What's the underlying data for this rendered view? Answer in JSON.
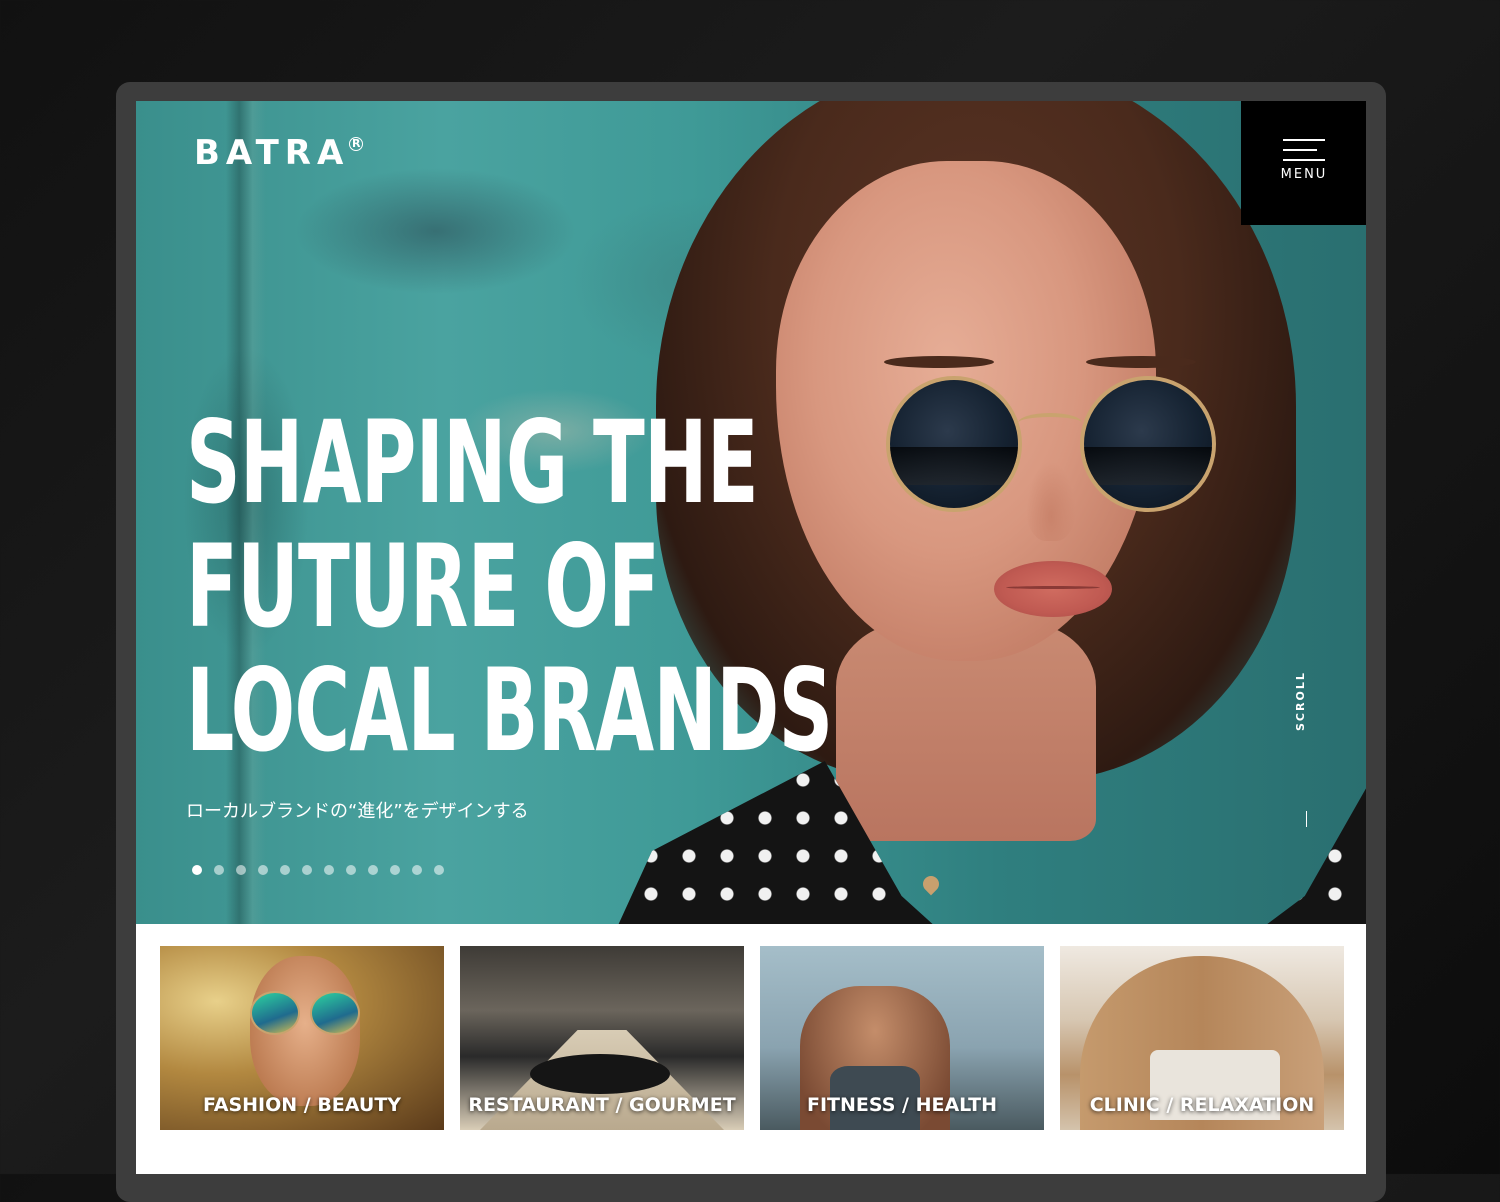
{
  "brand": {
    "name": "BATRA",
    "mark": "R"
  },
  "menu": {
    "label": "MENU"
  },
  "hero": {
    "headline_lines": [
      "SHAPING THE",
      "FUTURE OF",
      "LOCAL BRANDS"
    ],
    "subline": "ローカルブランドの“進化”をデザインする",
    "slide_count": 12,
    "active_slide": 1,
    "scroll_label": "SCROLL"
  },
  "categories": [
    {
      "label": "FASHION / BEAUTY"
    },
    {
      "label": "RESTAURANT / GOURMET"
    },
    {
      "label": "FITNESS / HEALTH"
    },
    {
      "label": "CLINIC / RELAXATION"
    }
  ],
  "colors": {
    "accent": "#000000",
    "text_on_image": "#ffffff",
    "wall": "#3f9a97"
  }
}
